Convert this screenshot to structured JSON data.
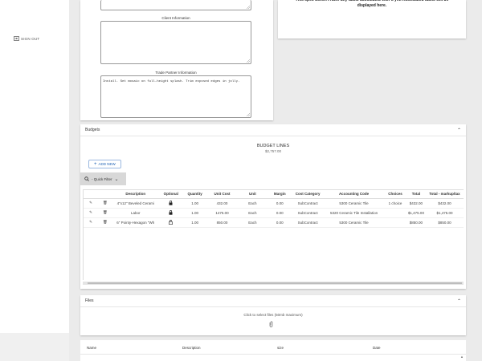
{
  "sidebar": {
    "signout_label": "SIGN OUT"
  },
  "spec": {
    "client_info_label": "Client Information",
    "client_info_value": "",
    "trade_partner_label": "Trade Partner Information",
    "trade_partner_value": "Install. Set mosaic on full-height splash. Trim exposed edges in jolly."
  },
  "tasks": {
    "message": "This spec doesn't have any tasks associated with it yet. Associated tasks will be displayed here."
  },
  "budgets": {
    "panel_title": "Budgets",
    "section_title": "BUDGET LINES",
    "total": "$2,757.00",
    "add_new_label": "ADD NEW",
    "quick_filter_label": "- Quick Filter",
    "columns": [
      "Description",
      "Optional",
      "Quantity",
      "Unit Cost",
      "Unit",
      "Margin",
      "Cost Category",
      "Accounting Code",
      "Choices",
      "Total",
      "Total - markup/tax"
    ],
    "rows": [
      {
        "description": "4\"x12\" Beveled Cerami",
        "quantity": "1.00",
        "unit_cost": "432.00",
        "unit": "Each",
        "margin": "0.00",
        "cost_category": "SubContract",
        "accounting_code": "5300 Ceramic Tile",
        "choices": "1 choice",
        "total": "$432.00",
        "total_markup": "$432.00",
        "optional_icon": "lock-closed-icon"
      },
      {
        "description": "Labor",
        "quantity": "1.00",
        "unit_cost": "1475.00",
        "unit": "Each",
        "margin": "0.00",
        "cost_category": "SubContract",
        "accounting_code": "5320 Ceramic Tile Installation",
        "choices": "",
        "total": "$1,475.00",
        "total_markup": "$1,475.00",
        "optional_icon": "lock-closed-icon"
      },
      {
        "description": "6\" Pointy-Hexagon \"Wh",
        "quantity": "1.00",
        "unit_cost": "850.00",
        "unit": "Each",
        "margin": "0.00",
        "cost_category": "SubContract",
        "accounting_code": "5300 Ceramic Tile",
        "choices": "",
        "total": "$850.00",
        "total_markup": "$850.00",
        "optional_icon": "lock-open-icon"
      }
    ]
  },
  "files": {
    "panel_title": "Files",
    "drop_text": "Click to select files (50mb maximum)",
    "columns": [
      "Name",
      "Description",
      "size",
      "Date"
    ]
  }
}
